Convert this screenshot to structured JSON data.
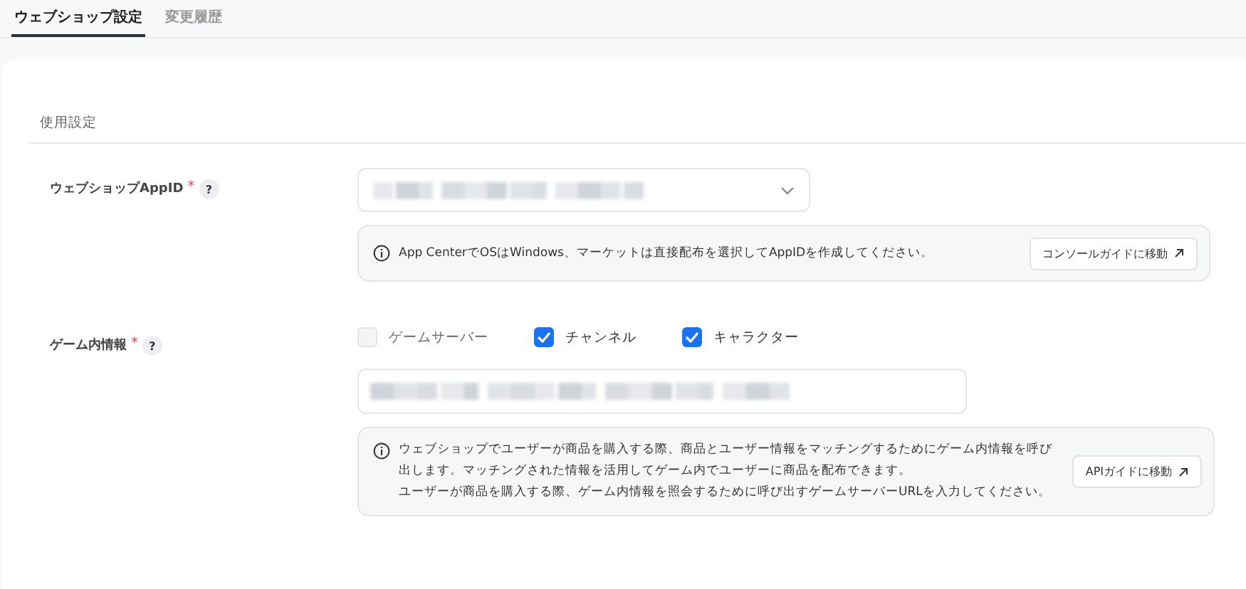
{
  "tabs": [
    {
      "label": "ウェブショップ設定",
      "selected": true
    },
    {
      "label": "変更履歴",
      "selected": false
    }
  ],
  "section": {
    "title": "使用設定"
  },
  "fields": [
    {
      "kind": "select",
      "label": "ウェブショップAppID",
      "required_mark": "*",
      "help": "?",
      "notice": {
        "paragraphs": [
          "App CenterでOSはWindows、マーケットは直接配布を選択してAppIDを作成してください。"
        ],
        "button": "コンソールガイドに移動"
      }
    },
    {
      "kind": "checks",
      "label": "ゲーム内情報",
      "required_mark": "*",
      "help": "?",
      "options": [
        {
          "label": "ゲームサーバー",
          "checked": false,
          "disabled": true
        },
        {
          "label": "チャンネル",
          "checked": true,
          "disabled": false
        },
        {
          "label": "キャラクター",
          "checked": true,
          "disabled": false
        }
      ],
      "notice": {
        "paragraphs": [
          "ウェブショップでユーザーが商品を購入する際、商品とユーザー情報をマッチングするためにゲーム内情報を呼び出します。マッチングされた情報を活用してゲーム内でユーザーに商品を配布できます。",
          "ユーザーが商品を購入する際、ゲーム内情報を照会するために呼び出すゲームサーバーURLを入力してください。"
        ],
        "button": "APIガイドに移動"
      }
    }
  ]
}
